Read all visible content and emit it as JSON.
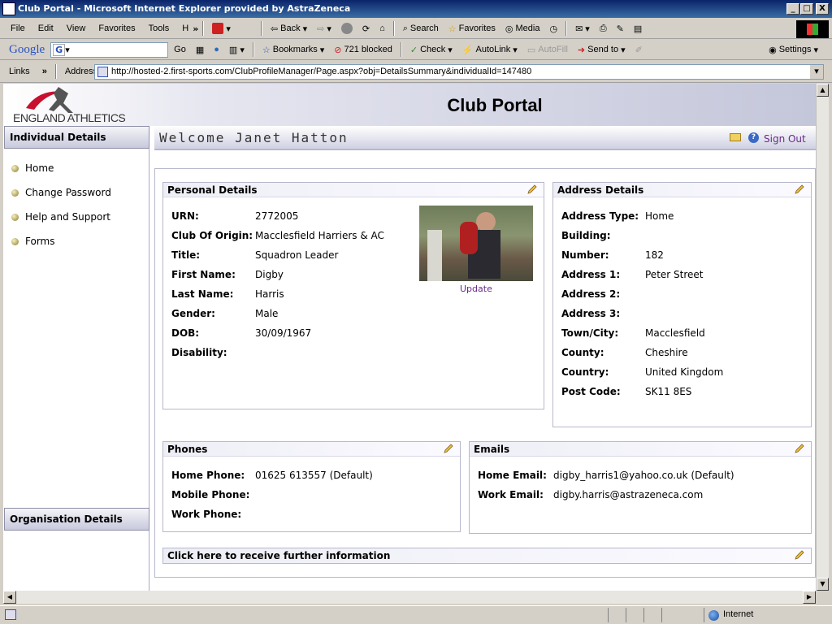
{
  "window": {
    "title": "Club Portal - Microsoft Internet Explorer provided by AstraZeneca",
    "buttons": [
      "_",
      "□",
      "X"
    ]
  },
  "menu": [
    "File",
    "Edit",
    "View",
    "Favorites",
    "Tools",
    "H"
  ],
  "toolbar": {
    "back": "Back",
    "search": "Search",
    "favorites": "Favorites",
    "media": "Media"
  },
  "google": {
    "brand": "Google",
    "go": "Go",
    "blocked": "721 blocked",
    "check": "Check",
    "autolink": "AutoLink",
    "autofill": "AutoFill",
    "sendto": "Send to",
    "settings": "Settings",
    "bookmarks": "Bookmarks"
  },
  "address": {
    "links": "Links",
    "label": "Address",
    "url": "http://hosted-2.first-sports.com/ClubProfileManager/Page.aspx?obj=DetailsSummary&individualId=147480"
  },
  "status": {
    "zone": "Internet"
  },
  "banner": {
    "logo": "ENGLAND ATHLETICS",
    "title": "Club Portal"
  },
  "sidebar": {
    "section1": "Individual Details",
    "items": [
      "Home",
      "Change Password",
      "Help and Support",
      "Forms"
    ],
    "section2": "Organisation Details"
  },
  "welcome": {
    "text": "Welcome Janet Hatton",
    "signout": "Sign Out"
  },
  "personal": {
    "heading": "Personal Details",
    "update": "Update",
    "rows": [
      {
        "label": "URN:",
        "value": "2772005"
      },
      {
        "label": "Club Of Origin:",
        "value": "Macclesfield Harriers & AC"
      },
      {
        "label": "Title:",
        "value": "Squadron Leader"
      },
      {
        "label": "First Name:",
        "value": "Digby"
      },
      {
        "label": "Last Name:",
        "value": "Harris"
      },
      {
        "label": "Gender:",
        "value": "Male"
      },
      {
        "label": "DOB:",
        "value": "30/09/1967"
      },
      {
        "label": "Disability:",
        "value": ""
      }
    ]
  },
  "address_details": {
    "heading": "Address Details",
    "rows": [
      {
        "label": "Address Type:",
        "value": "Home"
      },
      {
        "label": "Building:",
        "value": ""
      },
      {
        "label": "Number:",
        "value": "182"
      },
      {
        "label": "Address 1:",
        "value": "Peter Street"
      },
      {
        "label": "Address 2:",
        "value": ""
      },
      {
        "label": "Address 3:",
        "value": ""
      },
      {
        "label": "Town/City:",
        "value": "Macclesfield"
      },
      {
        "label": "County:",
        "value": "Cheshire"
      },
      {
        "label": "Country:",
        "value": "United Kingdom"
      },
      {
        "label": "Post Code:",
        "value": "SK11 8ES"
      }
    ]
  },
  "phones": {
    "heading": "Phones",
    "rows": [
      {
        "label": "Home Phone:",
        "value": "01625 613557 (Default)"
      },
      {
        "label": "Mobile Phone:",
        "value": ""
      },
      {
        "label": "Work Phone:",
        "value": ""
      }
    ]
  },
  "emails": {
    "heading": "Emails",
    "rows": [
      {
        "label": "Home Email:",
        "value": "digby_harris1@yahoo.co.uk (Default)"
      },
      {
        "label": "Work Email:",
        "value": "digby.harris@astrazeneca.com"
      }
    ]
  },
  "info": {
    "text": "Click here to receive further information"
  },
  "colors": {
    "accent": "#6b2a8a",
    "header_grad": "#c8c9dc"
  }
}
